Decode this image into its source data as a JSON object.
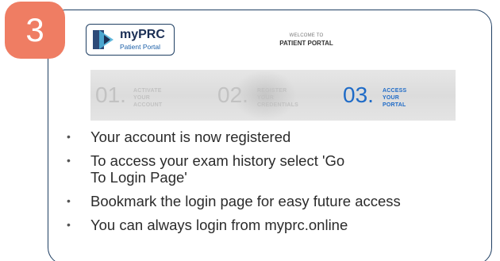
{
  "step_badge": "3",
  "logo": {
    "title": "myPRC",
    "subtitle": "Patient Portal"
  },
  "header": {
    "welcome": "WELCOME TO",
    "title": "PATIENT PORTAL"
  },
  "steps": [
    {
      "number": "01.",
      "line1": "ACTIVATE",
      "line2": "YOUR ACCOUNT",
      "active": false
    },
    {
      "number": "02.",
      "line1": "REGISTER",
      "line2": "YOUR CREDENTIALS",
      "active": false
    },
    {
      "number": "03.",
      "line1": "ACCESS",
      "line2": "YOUR PORTAL",
      "active": true
    }
  ],
  "bullets": [
    "Your account is now registered",
    "To access your exam history select 'Go To Login Page'",
    "Bookmark the login page for easy future access",
    "You can always login from myprc.online"
  ],
  "bullet_glyph": "•",
  "colors": {
    "accent": "#ef7d63",
    "border": "#1f3f63",
    "active_step": "#1f6bc7",
    "inactive_step": "#c2c2c2"
  }
}
